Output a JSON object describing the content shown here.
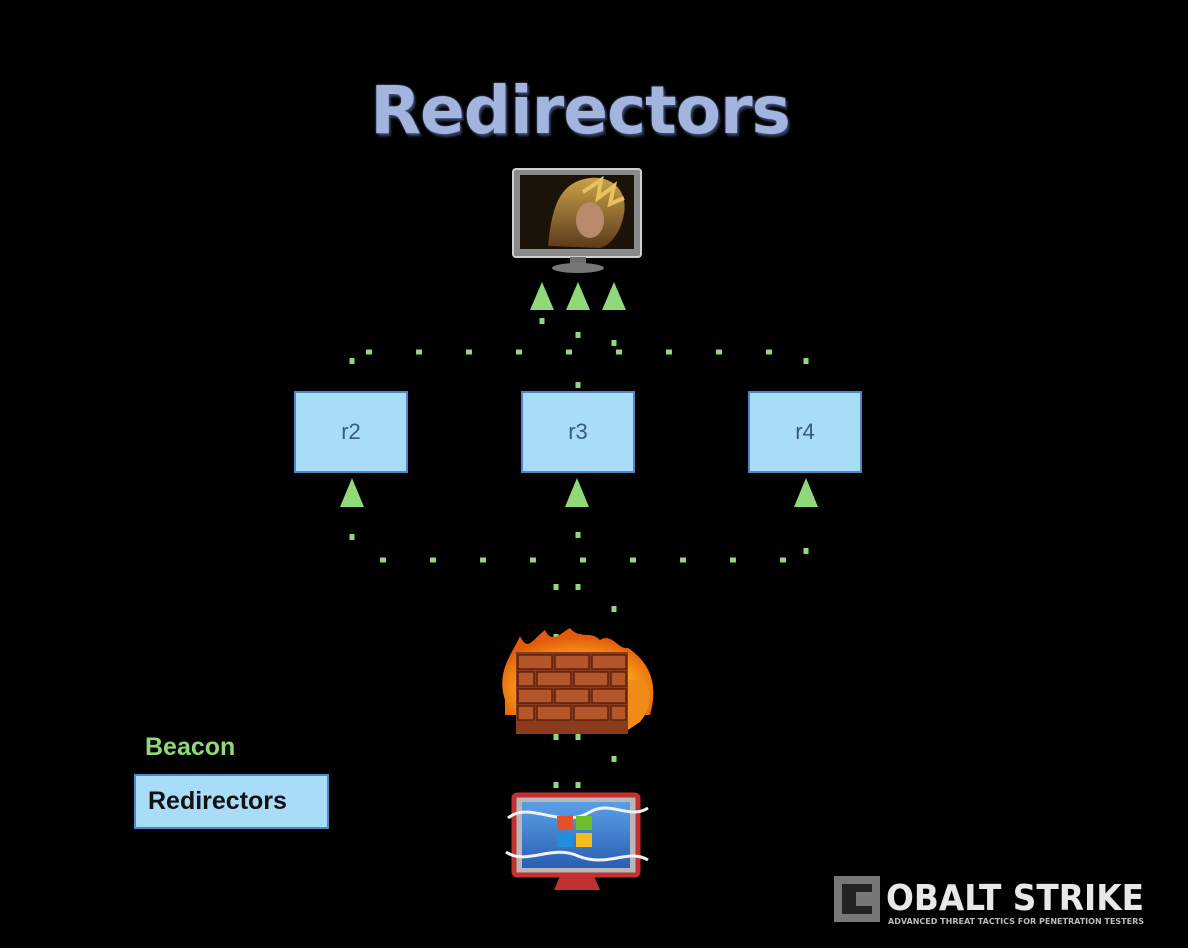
{
  "title": "Redirectors",
  "nodes": [
    {
      "id": "r2",
      "label": "r2"
    },
    {
      "id": "r3",
      "label": "r3"
    },
    {
      "id": "r4",
      "label": "r4"
    }
  ],
  "legend": {
    "beacon_label": "Beacon",
    "redirectors_label": "Redirectors"
  },
  "logo": {
    "brand": "COBALT STRIKE",
    "tagline": "ADVANCED THREAT TACTICS FOR PENETRATION TESTERS"
  },
  "colors": {
    "background": "#000000",
    "title": "#a3b5df",
    "beacon_green": "#8fd97a",
    "node_fill": "#a9dcf7",
    "node_border": "#4e86c6"
  },
  "icons": {
    "attacker": "attacker-monitor-icon",
    "firewall": "firewall-icon",
    "target": "windows-target-icon"
  }
}
